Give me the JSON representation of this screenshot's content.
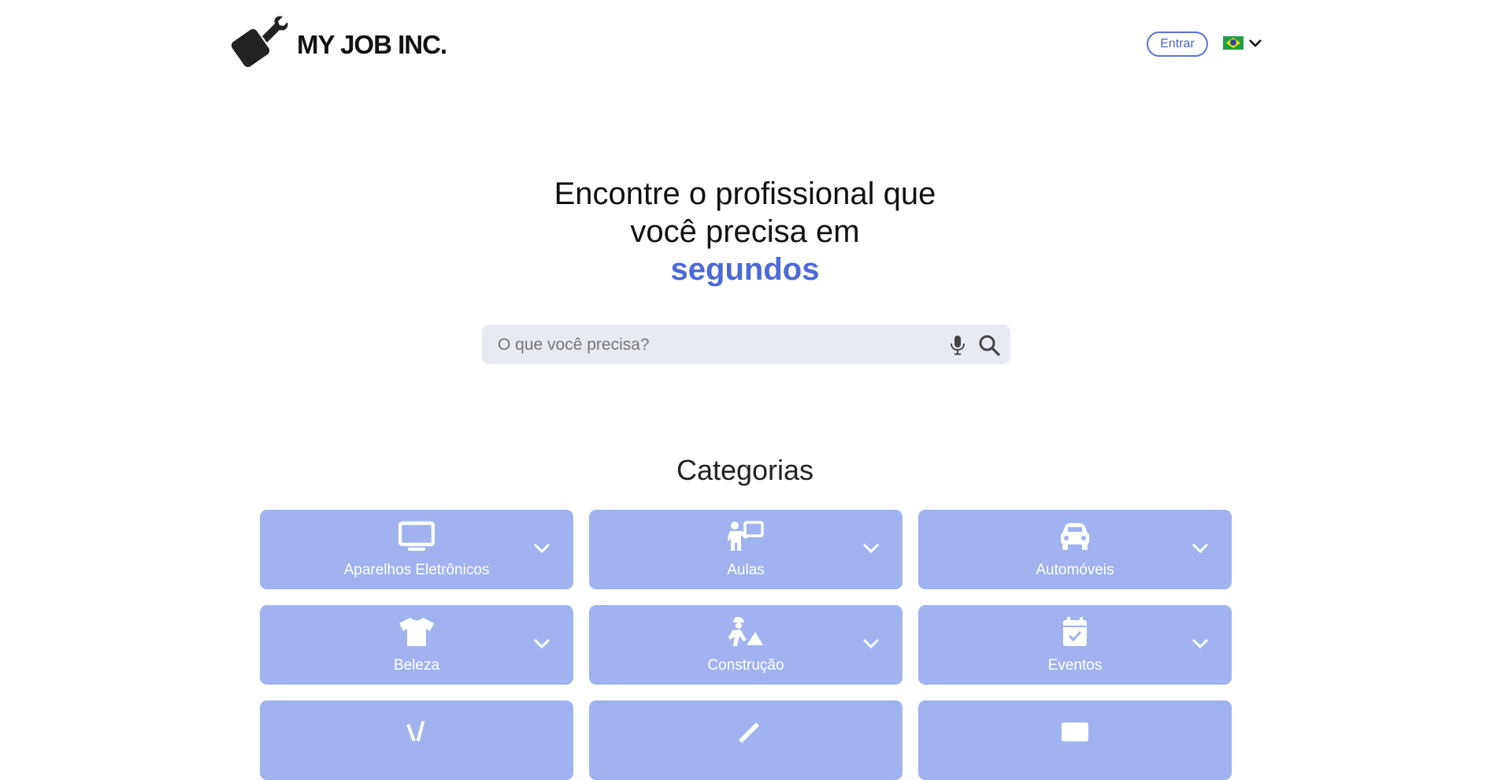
{
  "header": {
    "logo_text": "MY JOB INC.",
    "login_label": "Entrar",
    "language": "pt-BR"
  },
  "hero": {
    "line1": "Encontre o profissional que",
    "line2": "você precisa em",
    "accent": "segundos"
  },
  "search": {
    "placeholder": "O que você precisa?",
    "value": ""
  },
  "categories": {
    "title": "Categorias",
    "items": [
      {
        "label": "Aparelhos Eletrônicos",
        "icon": "monitor-icon"
      },
      {
        "label": "Aulas",
        "icon": "teacher-icon"
      },
      {
        "label": "Automóveis",
        "icon": "car-icon"
      },
      {
        "label": "Beleza",
        "icon": "tshirt-icon"
      },
      {
        "label": "Construção",
        "icon": "construction-worker-icon"
      },
      {
        "label": "Eventos",
        "icon": "calendar-check-icon"
      },
      {
        "label": "",
        "icon": "tools-icon"
      },
      {
        "label": "",
        "icon": "pencil-icon"
      },
      {
        "label": "",
        "icon": "id-card-icon"
      }
    ]
  },
  "colors": {
    "accent": "#4a6ad8",
    "card": "#a0b3ee",
    "search_bg": "#e8eaf2"
  }
}
